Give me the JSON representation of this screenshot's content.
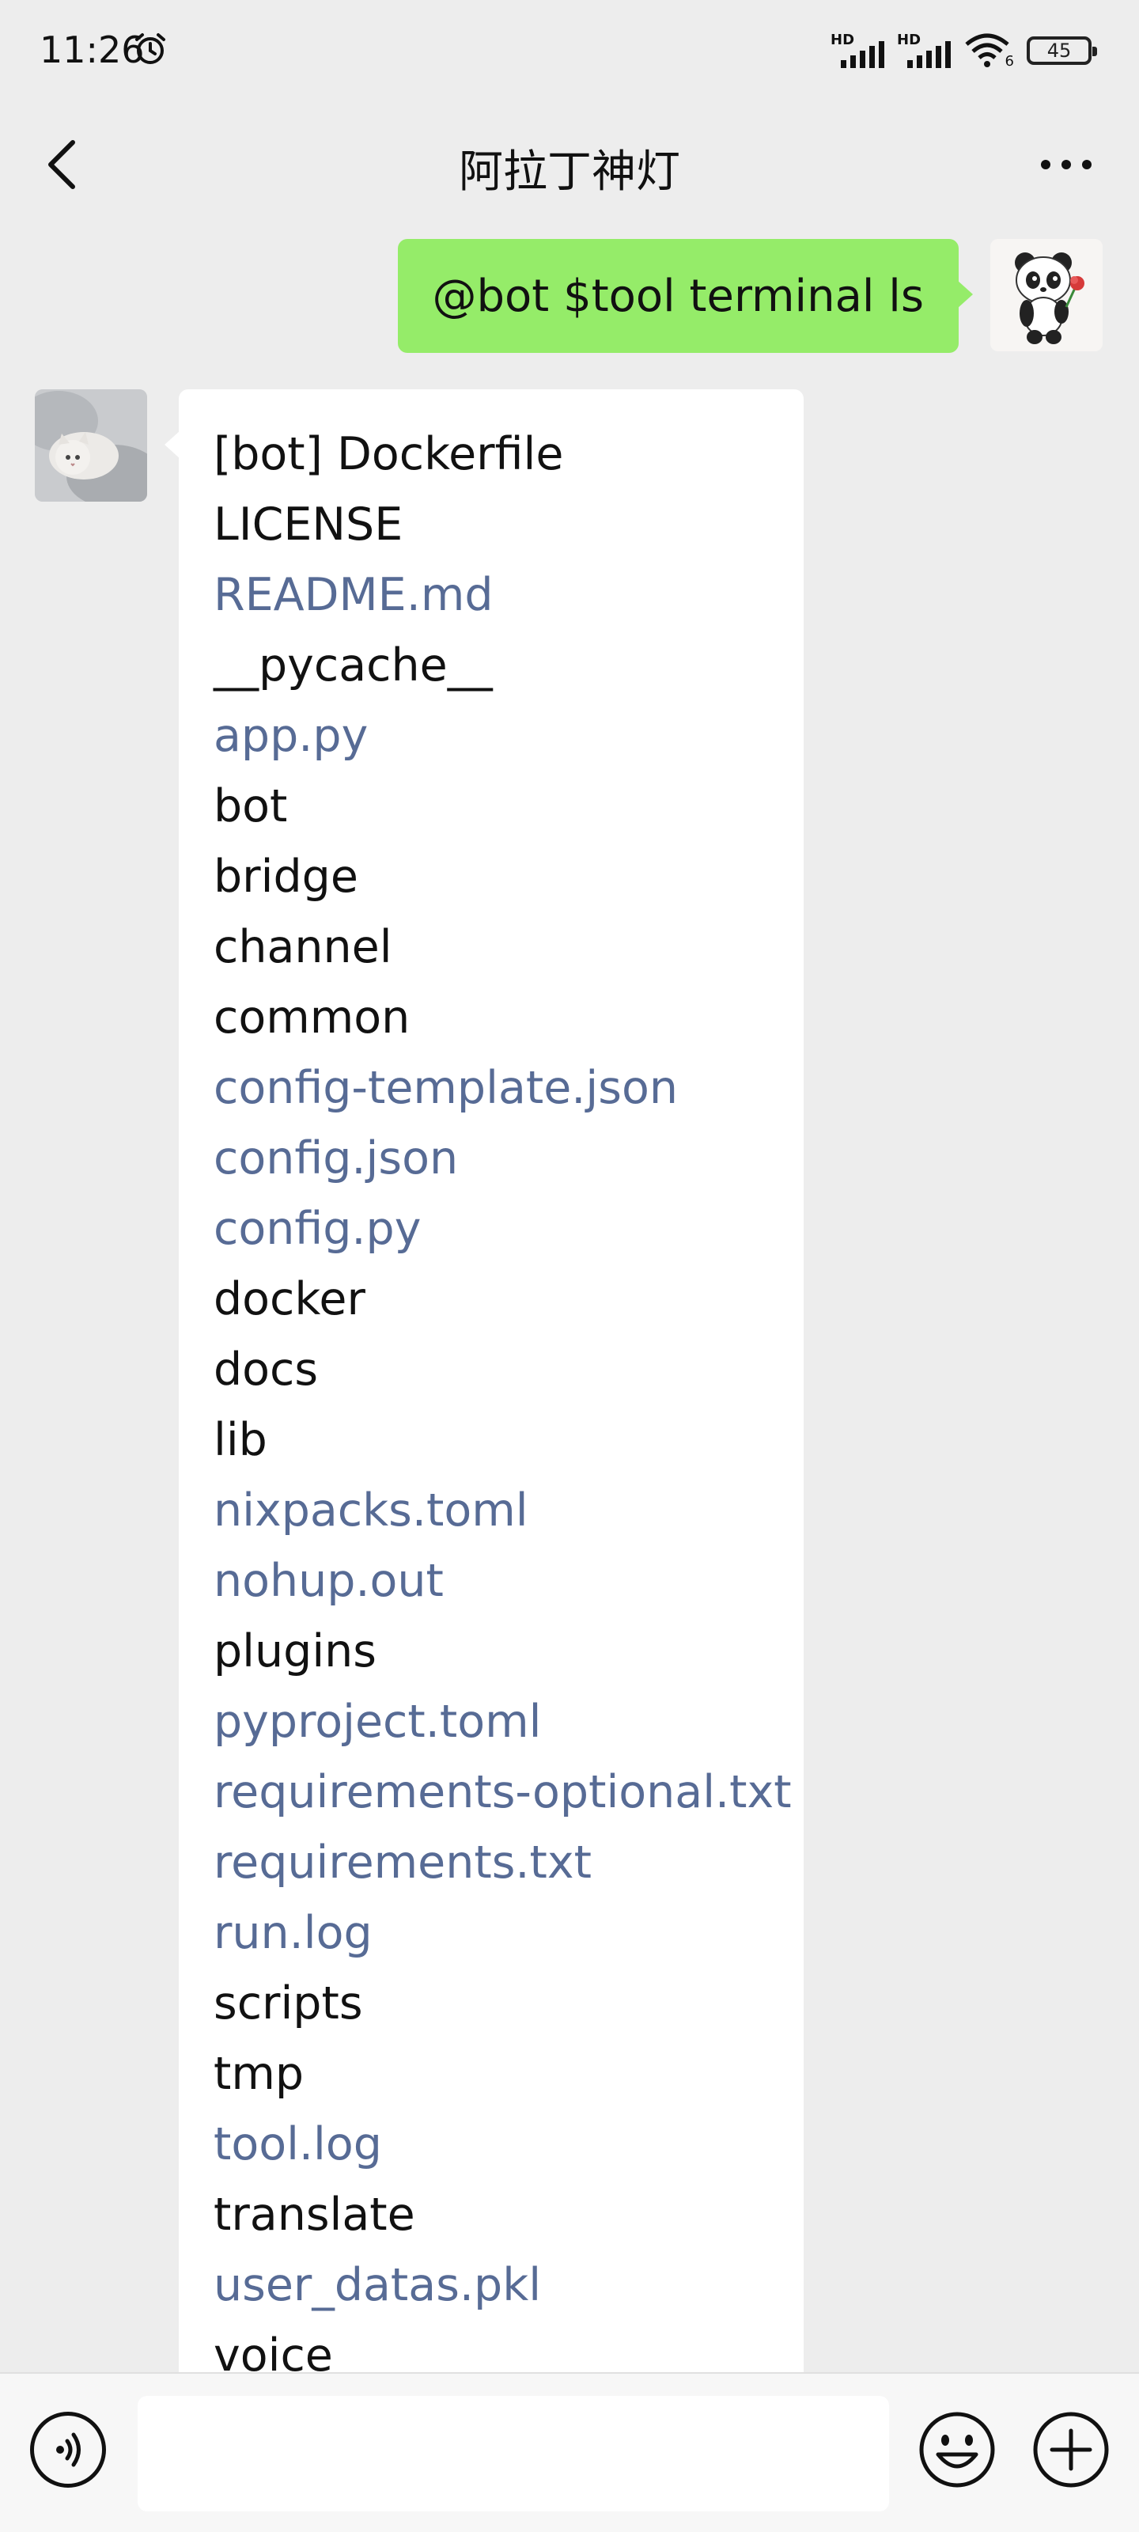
{
  "status_bar": {
    "time": "11:26",
    "battery": "45",
    "signal_1": "HD",
    "signal_2": "HD",
    "wifi_badge": "6"
  },
  "header": {
    "title": "阿拉丁神灯"
  },
  "messages": {
    "outgoing_text": "@bot $tool terminal ls",
    "incoming_lines": [
      "[bot] Dockerfile",
      "LICENSE",
      "README.md",
      "__pycache__",
      "app.py",
      "bot",
      "bridge",
      "channel",
      "common",
      "config-template.json",
      "config.json",
      "config.py",
      "docker",
      "docs",
      "lib",
      "nixpacks.toml",
      "nohup.out",
      "plugins",
      "pyproject.toml",
      "requirements-optional.txt",
      "requirements.txt",
      "run.log",
      "scripts",
      "tmp",
      "tool.log",
      "translate",
      "user_datas.pkl",
      "voice"
    ]
  },
  "input": {
    "value": ""
  },
  "colors": {
    "background": "#ededed",
    "outgoing_bubble": "#95ec69",
    "incoming_bubble": "#ffffff",
    "link_text": "#576b95"
  },
  "icons": {
    "back": "chevron-left-icon",
    "more": "more-dots-icon",
    "voice": "voice-icon",
    "emoji": "emoji-icon",
    "plus": "plus-icon",
    "alarm": "alarm-icon"
  }
}
